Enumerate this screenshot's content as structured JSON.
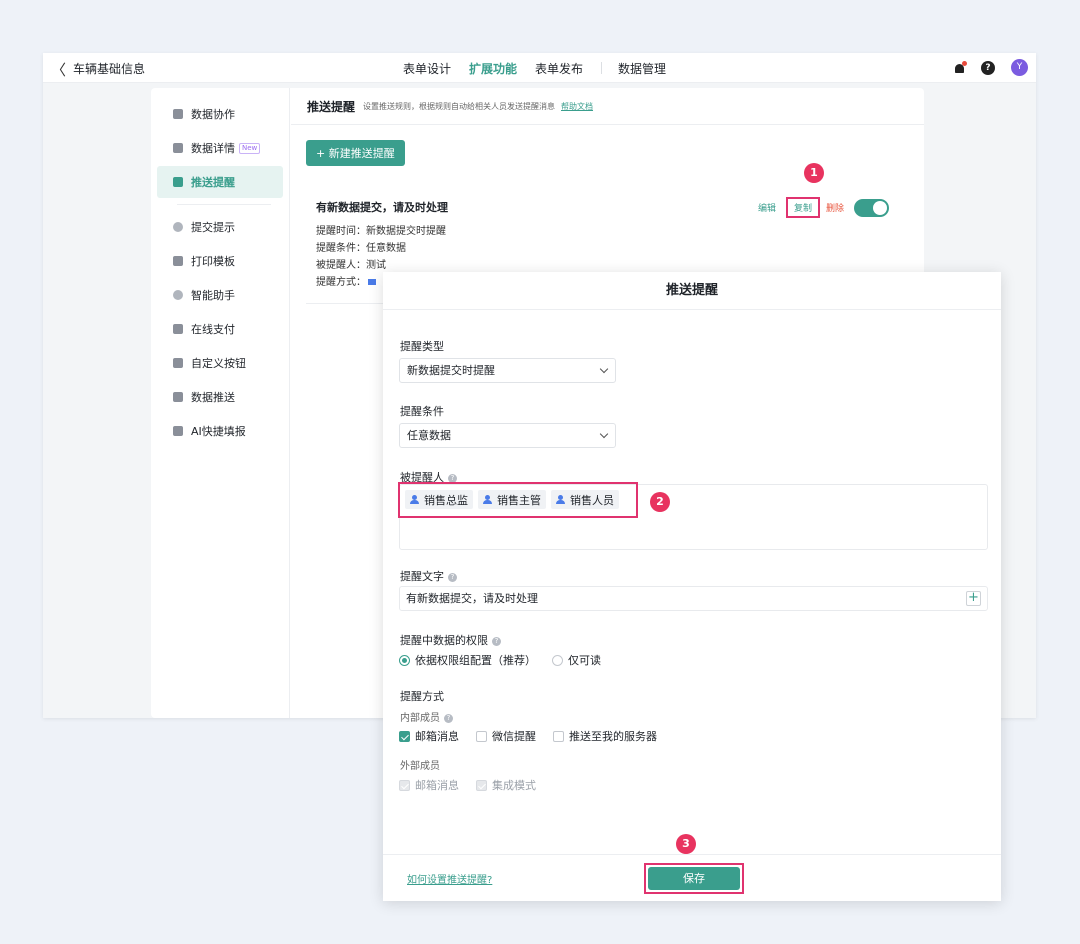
{
  "app": {
    "back_glyph": "〈",
    "title": "车辆基础信息"
  },
  "top_tabs": [
    {
      "label": "表单设计"
    },
    {
      "label": "扩展功能"
    },
    {
      "label": "表单发布"
    },
    {
      "label": "数据管理"
    }
  ],
  "topbar_icons": {
    "help": "?",
    "avatar": "Y"
  },
  "sidebar": {
    "items": [
      {
        "label": "数据协作",
        "icon": "table-icon"
      },
      {
        "label": "数据详情",
        "icon": "detail-icon",
        "badge": "New"
      },
      {
        "label": "推送提醒",
        "icon": "message-icon"
      },
      {
        "label": "提交提示",
        "icon": "check-circle-icon"
      },
      {
        "label": "打印模板",
        "icon": "printer-icon"
      },
      {
        "label": "智能助手",
        "icon": "bulb-icon"
      },
      {
        "label": "在线支付",
        "icon": "payment-icon"
      },
      {
        "label": "自定义按钮",
        "icon": "button-icon"
      },
      {
        "label": "数据推送",
        "icon": "push-icon"
      },
      {
        "label": "AI快捷填报",
        "icon": "ai-icon"
      }
    ]
  },
  "header": {
    "title": "推送提醒",
    "desc": "设置推送规则，根据规则自动给相关人员发送提醒消息",
    "help_link": "帮助文档"
  },
  "new_button": "+ 新建推送提醒",
  "rule": {
    "title": "有新数据提交，请及时处理",
    "lines": [
      "提醒时间：新数据提交时提醒",
      "提醒条件：任意数据",
      "被提醒人：测试",
      "提醒方式："
    ],
    "edit": "编辑",
    "copy": "复制",
    "delete": "删除"
  },
  "steps": [
    "1",
    "2",
    "3"
  ],
  "modal": {
    "title": "推送提醒",
    "type_label": "提醒类型",
    "type_value": "新数据提交时提醒",
    "cond_label": "提醒条件",
    "cond_value": "任意数据",
    "recipients_label": "被提醒人",
    "recipients": [
      "销售总监",
      "销售主管",
      "销售人员"
    ],
    "text_label": "提醒文字",
    "text_value": "有新数据提交，请及时处理",
    "perm_label": "提醒中数据的权限",
    "perm_options": [
      "依据权限组配置（推荐）",
      "仅可读"
    ],
    "method_label": "提醒方式",
    "internal_label": "内部成员",
    "internal_options": [
      "邮箱消息",
      "微信提醒",
      "推送至我的服务器"
    ],
    "external_label": "外部成员",
    "external_options": [
      "邮箱消息",
      "集成模式"
    ],
    "footer_link": "如何设置推送提醒?",
    "save": "保存"
  },
  "colors": {
    "accent": "#3a9e8d",
    "highlight": "#e0336f",
    "step": "#e8335f"
  }
}
